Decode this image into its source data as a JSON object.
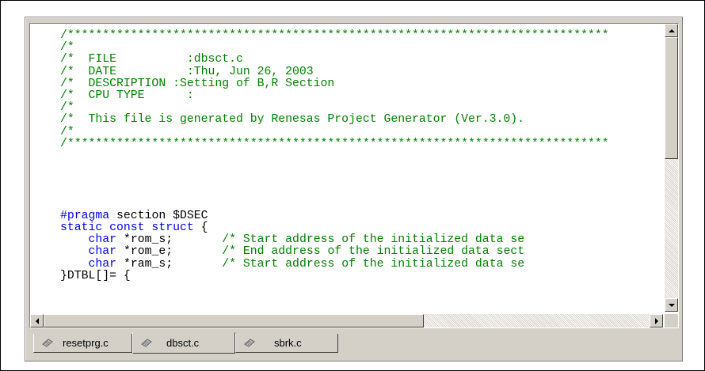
{
  "editor": {
    "lines": [
      [
        {
          "t": "/*****************************************************************************",
          "c": "cm"
        }
      ],
      [
        {
          "t": "/*",
          "c": "cm"
        }
      ],
      [
        {
          "t": "/*  FILE          :dbsct.c",
          "c": "cm"
        }
      ],
      [
        {
          "t": "/*  DATE          :Thu, Jun 26, 2003",
          "c": "cm"
        }
      ],
      [
        {
          "t": "/*  DESCRIPTION :Setting of B,R Section",
          "c": "cm"
        }
      ],
      [
        {
          "t": "/*  CPU TYPE      :",
          "c": "cm"
        }
      ],
      [
        {
          "t": "/*",
          "c": "cm"
        }
      ],
      [
        {
          "t": "/*  This file is generated by Renesas Project Generator (Ver.3.0).",
          "c": "cm"
        }
      ],
      [
        {
          "t": "/*",
          "c": "cm"
        }
      ],
      [
        {
          "t": "/*****************************************************************************",
          "c": "cm"
        }
      ],
      [],
      [],
      [],
      [],
      [],
      [
        {
          "t": "#pragma",
          "c": "kw"
        },
        {
          "t": " section $DSEC",
          "c": "pl"
        }
      ],
      [
        {
          "t": "static const struct",
          "c": "kw"
        },
        {
          "t": " {",
          "c": "pl"
        }
      ],
      [
        {
          "t": "    ",
          "c": "pl"
        },
        {
          "t": "char",
          "c": "kw"
        },
        {
          "t": " *rom_s;       ",
          "c": "pl"
        },
        {
          "t": "/* Start address of the initialized data se",
          "c": "cm"
        }
      ],
      [
        {
          "t": "    ",
          "c": "pl"
        },
        {
          "t": "char",
          "c": "kw"
        },
        {
          "t": " *rom_e;       ",
          "c": "pl"
        },
        {
          "t": "/* End address of the initialized data sect",
          "c": "cm"
        }
      ],
      [
        {
          "t": "    ",
          "c": "pl"
        },
        {
          "t": "char",
          "c": "kw"
        },
        {
          "t": " *ram_s;       ",
          "c": "pl"
        },
        {
          "t": "/* Start address of the initialized data se",
          "c": "cm"
        }
      ],
      [
        {
          "t": "}DTBL[]= {",
          "c": "pl"
        }
      ]
    ]
  },
  "tabs": [
    {
      "label": "resetprg.c",
      "icon": "file-icon",
      "active": false
    },
    {
      "label": "dbsct.c",
      "icon": "file-icon",
      "active": true
    },
    {
      "label": "sbrk.c",
      "icon": "file-icon",
      "active": false
    }
  ],
  "colors": {
    "comment": "#008000",
    "keyword": "#0000ff",
    "text": "#000000",
    "chrome": "#d4d0c8"
  }
}
